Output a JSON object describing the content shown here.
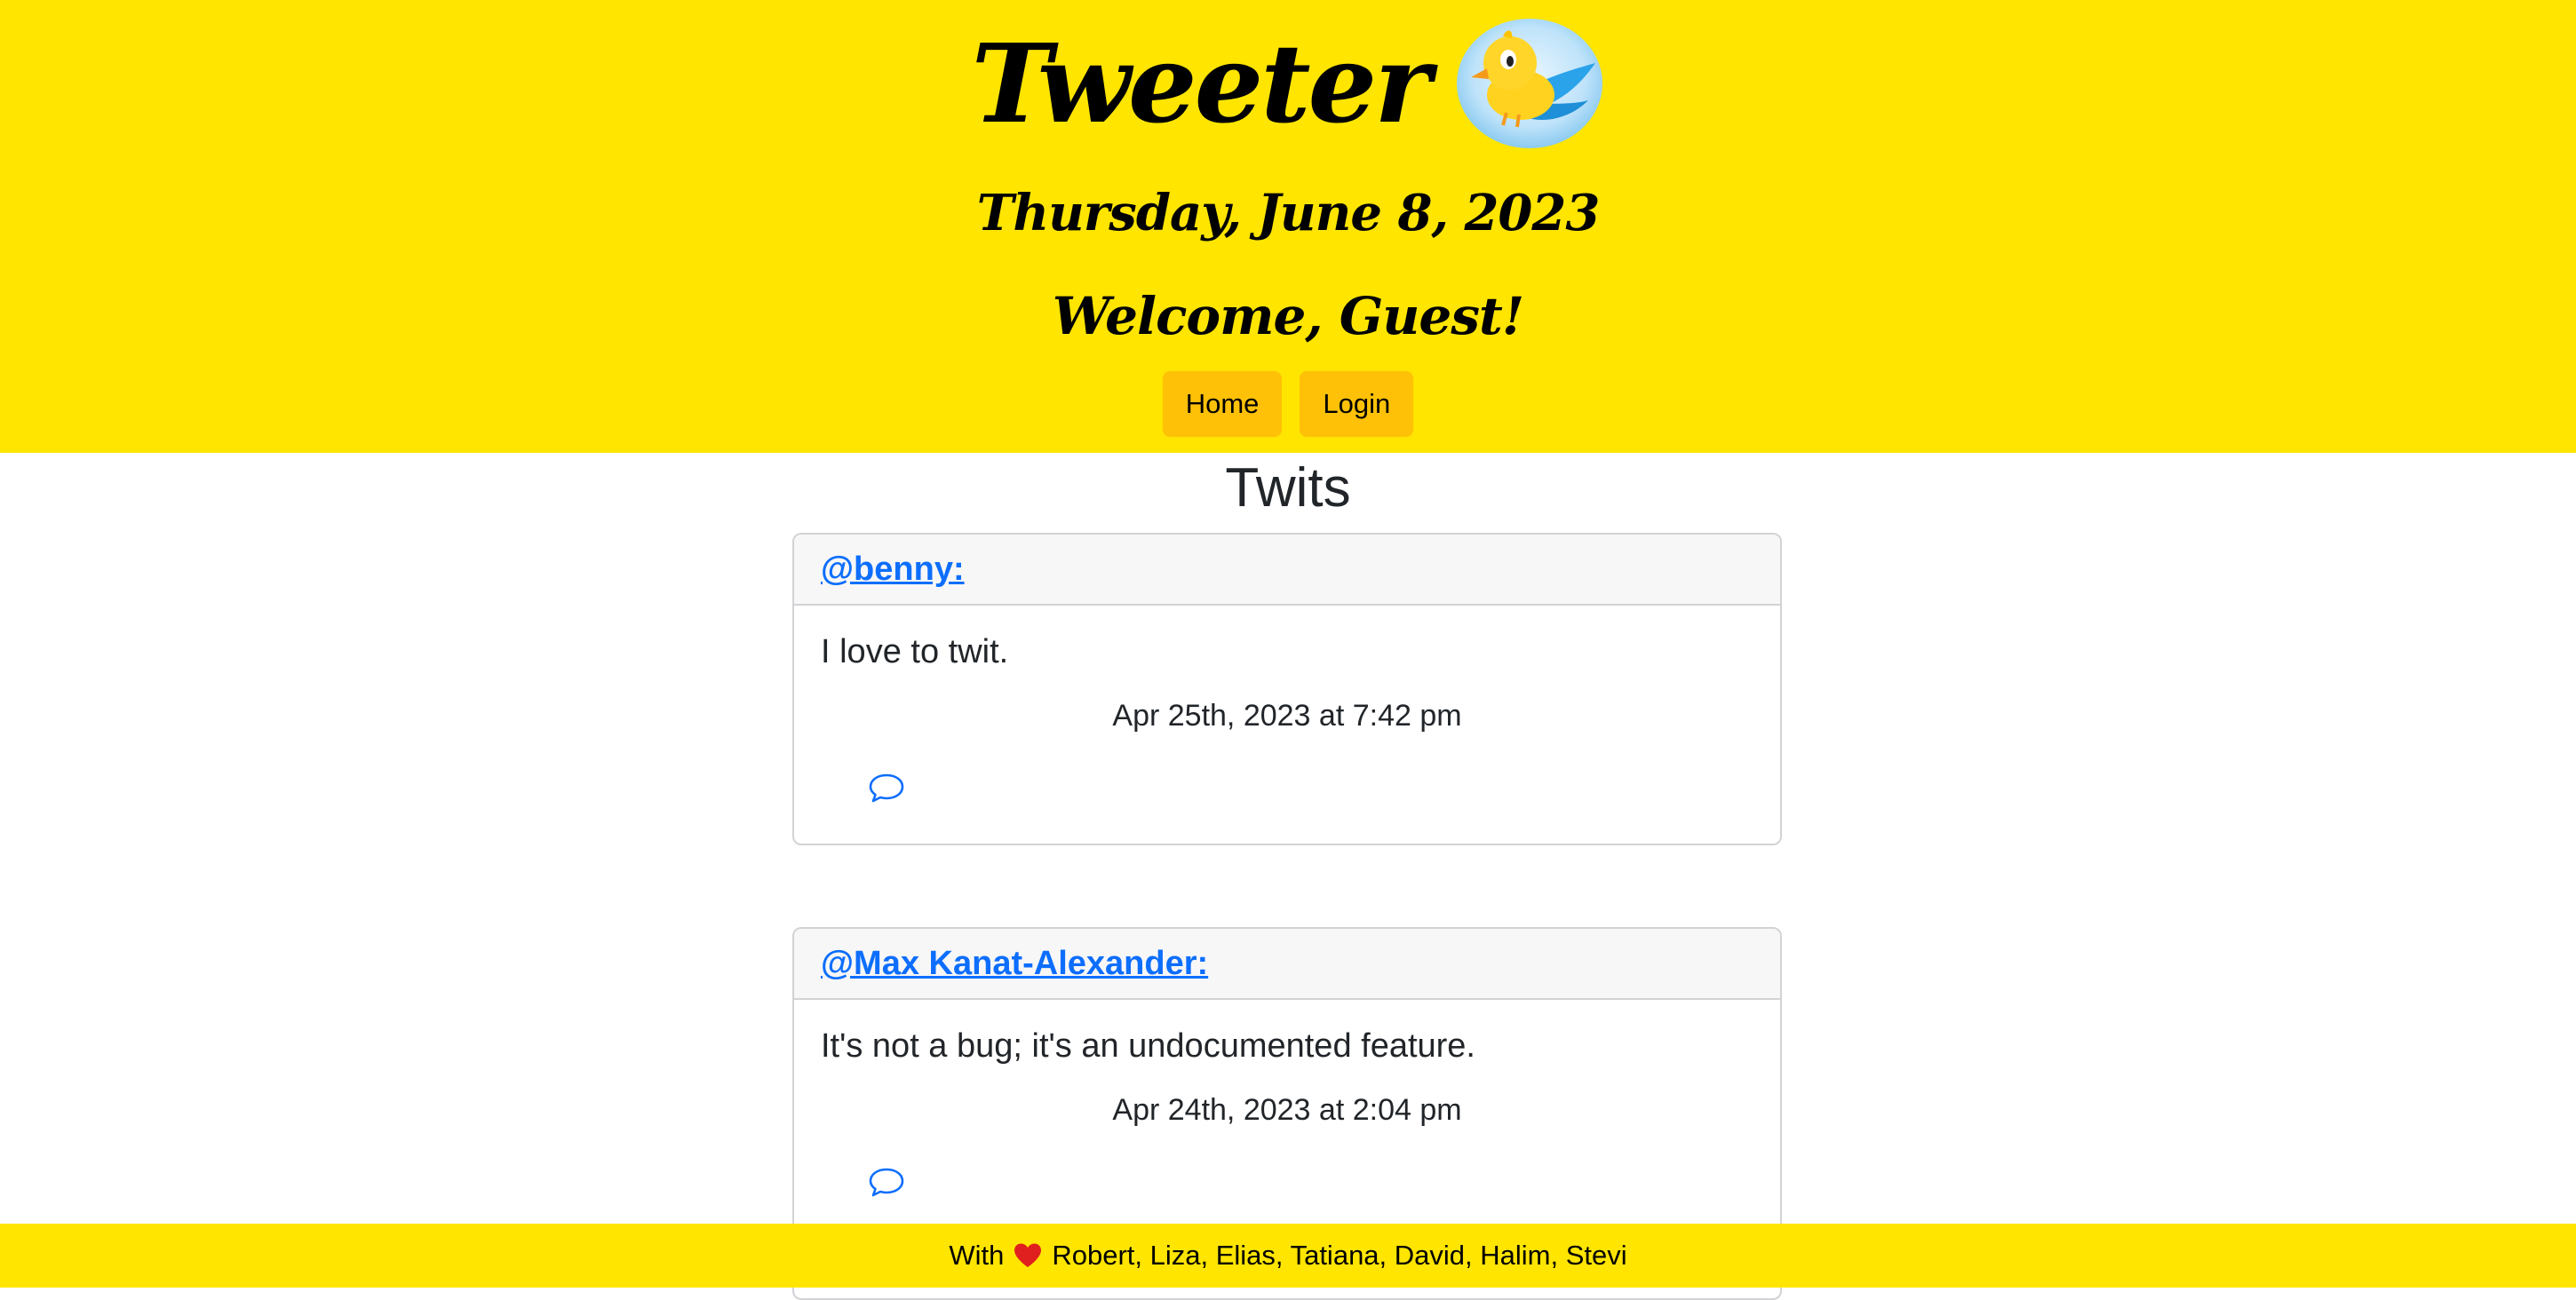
{
  "header": {
    "title": "Tweeter",
    "date": "Thursday, June 8, 2023",
    "welcome": "Welcome, Guest!",
    "logo_icon": "cartoon-bird-logo",
    "background_color": "#ffe500"
  },
  "nav": {
    "home_label": "Home",
    "login_label": "Login",
    "button_color": "#ffc107"
  },
  "main": {
    "section_title": "Twits",
    "twits": [
      {
        "author": "@benny:",
        "text": "I love to twit.",
        "timestamp": "Apr 25th, 2023 at 7:42 pm",
        "comment_icon": "speech-bubble-icon"
      },
      {
        "author": "@Max Kanat-Alexander:",
        "text": "It's not a bug; it's an undocumented feature.",
        "timestamp": "Apr 24th, 2023 at 2:04 pm",
        "comment_icon": "speech-bubble-icon"
      }
    ]
  },
  "footer": {
    "prefix": "With",
    "heart_icon": "heart-icon",
    "names": "Robert, Liza, Elias, Tatiana, David, Halim, Stevi"
  },
  "colors": {
    "link": "#0d6efd",
    "heart": "#e0201f"
  }
}
